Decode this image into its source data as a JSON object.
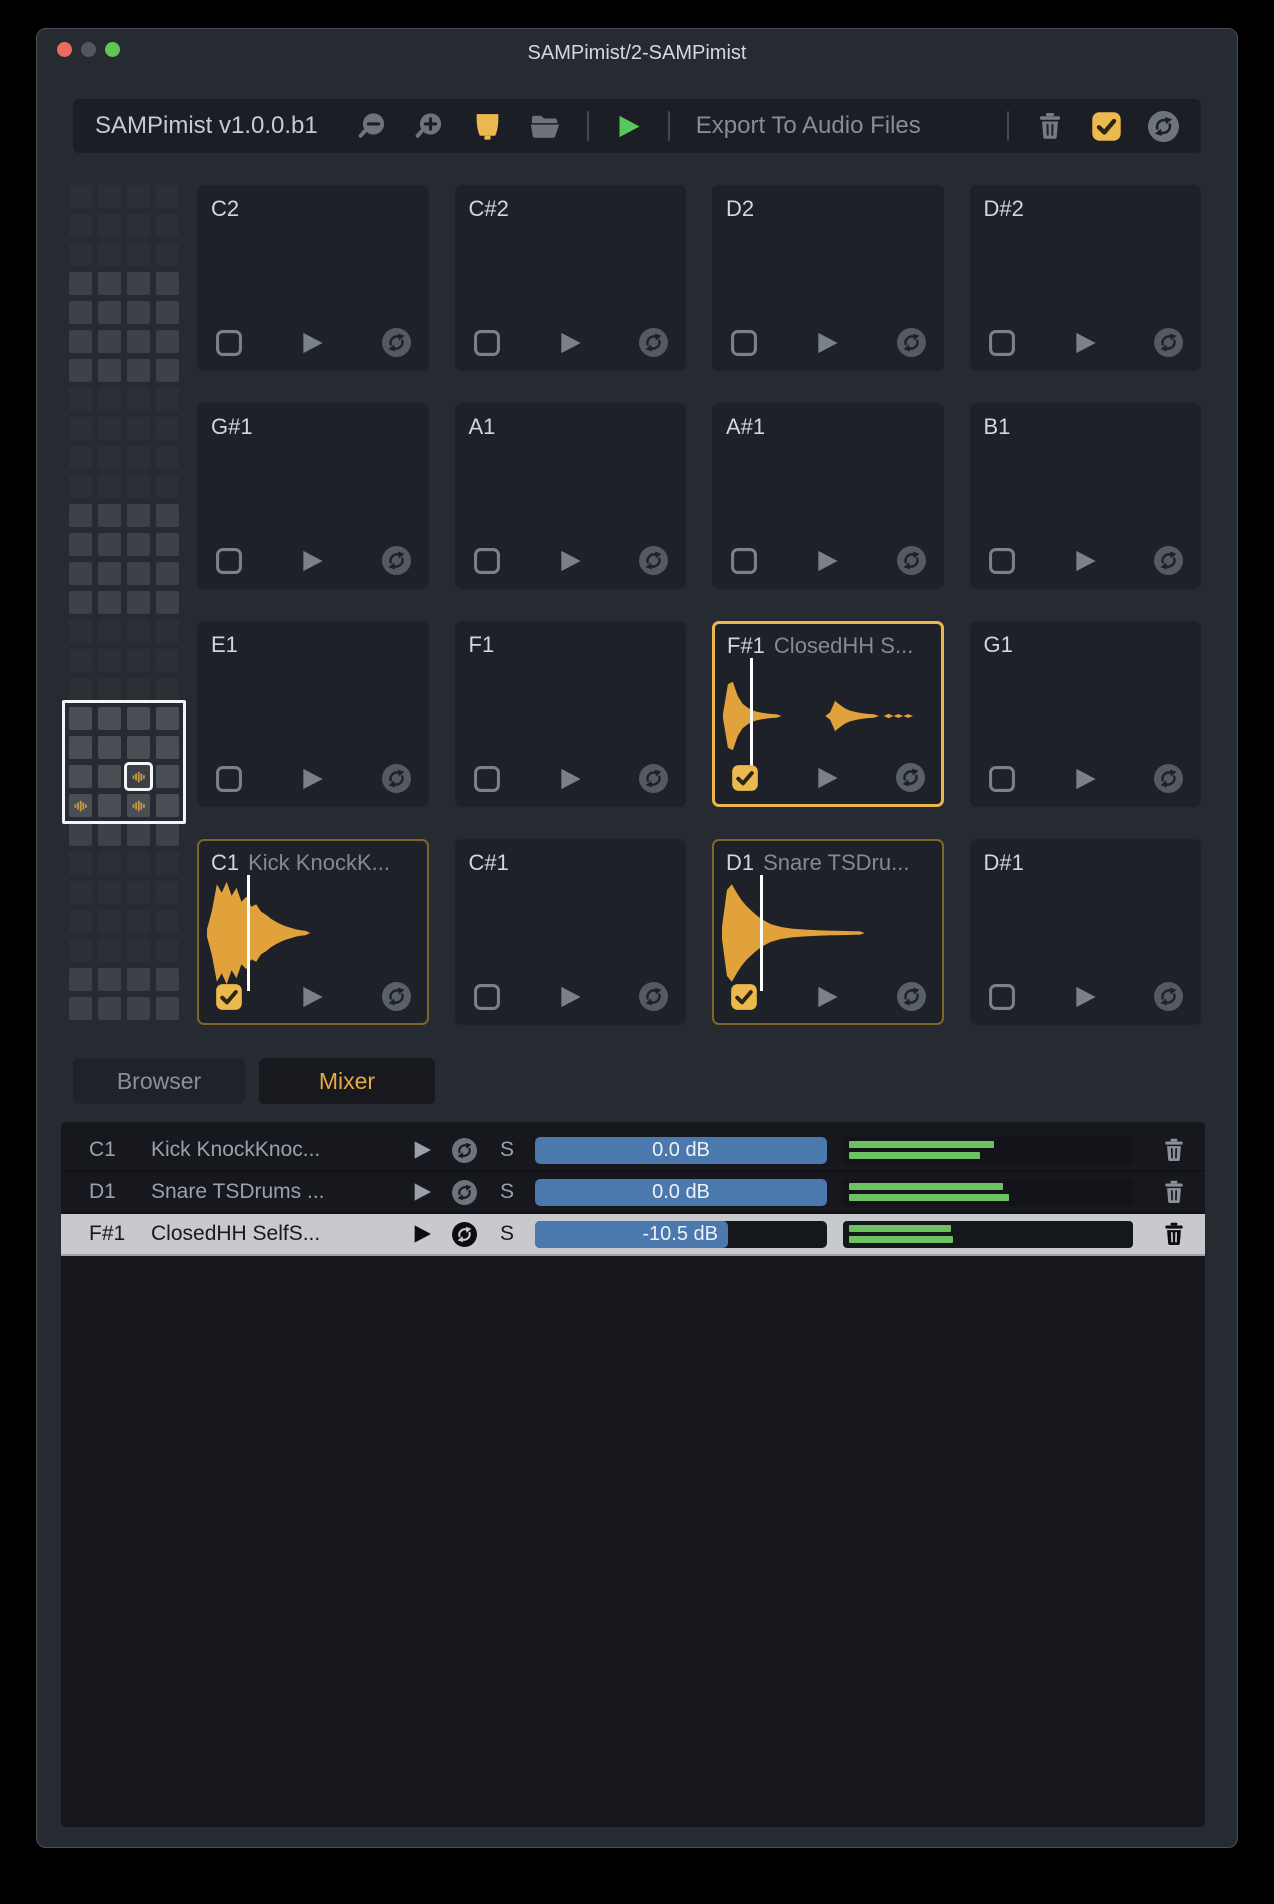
{
  "window_title": "SAMPimist/2-SAMPimist",
  "toolbar": {
    "version_label": "SAMPimist v1.0.0.b1",
    "export_label": "Export To Audio Files"
  },
  "tabs": {
    "browser": "Browser",
    "mixer": "Mixer"
  },
  "pads": [
    {
      "note": "C2",
      "name": "",
      "checked": false,
      "selected": false,
      "sample": null
    },
    {
      "note": "C#2",
      "name": "",
      "checked": false,
      "selected": false,
      "sample": null
    },
    {
      "note": "D2",
      "name": "",
      "checked": false,
      "selected": false,
      "sample": null
    },
    {
      "note": "D#2",
      "name": "",
      "checked": false,
      "selected": false,
      "sample": null
    },
    {
      "note": "G#1",
      "name": "",
      "checked": false,
      "selected": false,
      "sample": null
    },
    {
      "note": "A1",
      "name": "",
      "checked": false,
      "selected": false,
      "sample": null
    },
    {
      "note": "A#1",
      "name": "",
      "checked": false,
      "selected": false,
      "sample": null
    },
    {
      "note": "B1",
      "name": "",
      "checked": false,
      "selected": false,
      "sample": null
    },
    {
      "note": "E1",
      "name": "",
      "checked": false,
      "selected": false,
      "sample": null
    },
    {
      "note": "F1",
      "name": "",
      "checked": false,
      "selected": false,
      "sample": null
    },
    {
      "note": "F#1",
      "name": "ClosedHH S...",
      "checked": true,
      "selected": true,
      "sample": {
        "waveform": "hihat",
        "playhead": 0.155,
        "amp": 0.66
      }
    },
    {
      "note": "G1",
      "name": "",
      "checked": false,
      "selected": false,
      "sample": null
    },
    {
      "note": "C1",
      "name": "Kick KnockK...",
      "checked": true,
      "selected": false,
      "sample": {
        "waveform": "kick",
        "playhead": 0.21,
        "amp": 1.0
      }
    },
    {
      "note": "C#1",
      "name": "",
      "checked": false,
      "selected": false,
      "sample": null
    },
    {
      "note": "D1",
      "name": "Snare TSDru...",
      "checked": true,
      "selected": false,
      "sample": {
        "waveform": "snare",
        "playhead": 0.2,
        "amp": 0.95
      }
    },
    {
      "note": "D#1",
      "name": "",
      "checked": false,
      "selected": false,
      "sample": null
    }
  ],
  "waveforms": {
    "kick": [
      0.05,
      0.42,
      0.95,
      0.78,
      1.0,
      0.72,
      0.88,
      0.6,
      0.7,
      0.5,
      0.55,
      0.4,
      0.34,
      0.26,
      0.2,
      0.15,
      0.11,
      0.08,
      0.05,
      0.03,
      0.02,
      0,
      0,
      0,
      0,
      0,
      0,
      0,
      0,
      0,
      0,
      0,
      0,
      0,
      0,
      0,
      0,
      0,
      0,
      0,
      0,
      0,
      0,
      0
    ],
    "snare": [
      0.1,
      0.88,
      1.0,
      0.82,
      0.66,
      0.54,
      0.44,
      0.35,
      0.27,
      0.21,
      0.16,
      0.13,
      0.1,
      0.085,
      0.07,
      0.06,
      0.052,
      0.046,
      0.04,
      0.035,
      0.03,
      0.027,
      0.024,
      0.021,
      0.018,
      0.016,
      0.014,
      0.012,
      0.01,
      0,
      0,
      0,
      0,
      0,
      0,
      0,
      0,
      0,
      0,
      0,
      0,
      0,
      0,
      0
    ],
    "hihat": [
      0.04,
      0.92,
      1.0,
      0.58,
      0.34,
      0.22,
      0.14,
      0.09,
      0.06,
      0.04,
      0.025,
      0.015,
      0,
      0,
      0,
      0,
      0,
      0,
      0,
      0,
      0,
      0,
      0.08,
      0.42,
      0.3,
      0.2,
      0.13,
      0.09,
      0.06,
      0.04,
      0.025,
      0.015,
      0,
      0,
      0.03,
      0,
      0.025,
      0,
      0.02,
      0,
      0,
      0,
      0,
      0
    ]
  },
  "minimap": {
    "rows": 29,
    "cols": 4,
    "viewport_start_row": 18,
    "viewport_rows": 4,
    "selected_cell": {
      "row": 20,
      "col": 2
    },
    "marked_cells": [
      {
        "row": 21,
        "col": 0
      },
      {
        "row": 21,
        "col": 2
      }
    ]
  },
  "mixer_rows": [
    {
      "note": "C1",
      "name": "Kick KnockKnoc...",
      "solo": "S",
      "volume": "0.0 dB",
      "fill": 1.0,
      "meter": [
        0.5,
        0.45
      ],
      "selected": false
    },
    {
      "note": "D1",
      "name": "Snare TSDrums ...",
      "solo": "S",
      "volume": "0.0 dB",
      "fill": 1.0,
      "meter": [
        0.53,
        0.55
      ],
      "selected": false
    },
    {
      "note": "F#1",
      "name": "ClosedHH SelfS...",
      "solo": "S",
      "volume": "-10.5 dB",
      "fill": 0.66,
      "meter": [
        0.35,
        0.36
      ],
      "selected": true
    }
  ],
  "colors": {
    "accent": "#ecb94f",
    "check_mark": "#2b2517",
    "waveform": "#e2a23b",
    "slider_fill": "#4c79ad",
    "meter_green": "#6cc261",
    "play_green": "#58c75c",
    "selected_row_bg": "#c7c9cc",
    "toolbar_icon": "#6e747d",
    "pad_icon": "#7b818a"
  }
}
